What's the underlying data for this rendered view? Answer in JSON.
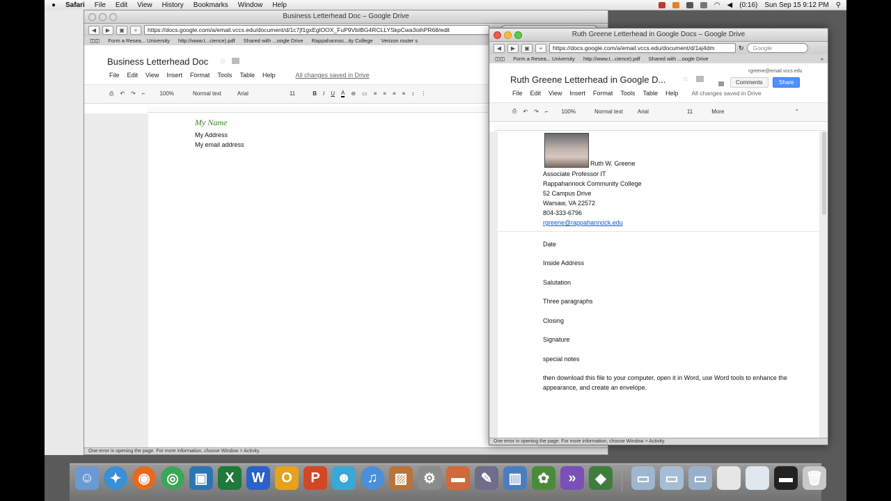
{
  "menubar": {
    "apple": "",
    "items": [
      "Safari",
      "File",
      "Edit",
      "View",
      "History",
      "Bookmarks",
      "Window",
      "Help"
    ],
    "battery": "(0:16)",
    "clock": "Sun Sep 15  9:12 PM"
  },
  "back_window": {
    "title": "Business Letterhead Doc – Google Drive",
    "url": "https://docs.google.com/a/email.vccs.edu/document/d/1c7jf1gxEglOOX_FuP9VbIBG4RCLLYSkpCwa3oihPR68/edit",
    "search_placeholder": "Google",
    "bookmarks": [
      "Form a Resea... University",
      "http://www.t...cience).pdf",
      "Shared with ...oogle Drive",
      "Rappahannoc...ity College",
      "Verizon router s"
    ],
    "doc_title": "Business Letterhead Doc",
    "menu": [
      "File",
      "Edit",
      "View",
      "Insert",
      "Format",
      "Tools",
      "Table",
      "Help"
    ],
    "saved": "All changes saved in Drive",
    "toolbar": {
      "zoom": "100%",
      "style": "Normal text",
      "font": "Arial",
      "size": "11"
    },
    "content": {
      "name": "My Name",
      "address": "My Address",
      "email": "My email address"
    },
    "status": "One error in opening the page. For more information, choose Window > Activity."
  },
  "front_window": {
    "title": "Ruth Greene Letterhead in Google Docs – Google Drive",
    "url": "https://docs.google.com/a/email.vccs.edu/document/d/1aj4dm",
    "search_placeholder": "Google",
    "bookmarks": [
      "Form a Resea... University",
      "http://www.t...cience).pdf",
      "Shared with ...oogle Drive"
    ],
    "doc_title": "Ruth Greene Letterhead in Google D...",
    "user_email": "rgreene@email.vccs.edu",
    "comments": "Comments",
    "share": "Share",
    "menu": [
      "File",
      "Edit",
      "View",
      "Insert",
      "Format",
      "Tools",
      "Table",
      "Help"
    ],
    "saved": "All changes saved in Drive",
    "toolbar": {
      "zoom": "100%",
      "style": "Normal text",
      "font": "Arial",
      "size": "11",
      "more": "More"
    },
    "letterhead": {
      "name": "Ruth W. Greene",
      "title": "Associate Professor IT",
      "org": "Rappahannock Community College",
      "street": "52 Campus Drive",
      "city": "Warsaw, VA 22572",
      "phone": "804-333-6796",
      "email": "rgreene@rappahannock.edu"
    },
    "body": [
      "Date",
      "Inside Address",
      "Salutation",
      "Three paragraphs",
      "Closing",
      "Signature",
      "special notes"
    ],
    "final_note_1": "then download this file to your computer, open it in Word, use Word tools to enhance the",
    "final_note_2": "appearance, and create an envelope.",
    "status": "One error in opening the page. For more information, choose Window > Activity."
  },
  "dock": {
    "icons": [
      "finder-icon",
      "safari-icon",
      "firefox-icon",
      "chrome-icon",
      "remote-desktop-icon",
      "excel-icon",
      "word-icon",
      "outlook-icon",
      "powerpoint-icon",
      "messenger-icon",
      "itunes-icon",
      "photos-icon",
      "system-prefs-icon",
      "keynote-icon",
      "pen-icon",
      "chart-icon",
      "evernote-icon",
      "clipboard-icon",
      "green-app-icon",
      "folder-icon",
      "documents-icon",
      "downloads-icon",
      "window-thumb-icon",
      "window-thumb2-icon",
      "terminal-icon",
      "trash-icon"
    ]
  }
}
